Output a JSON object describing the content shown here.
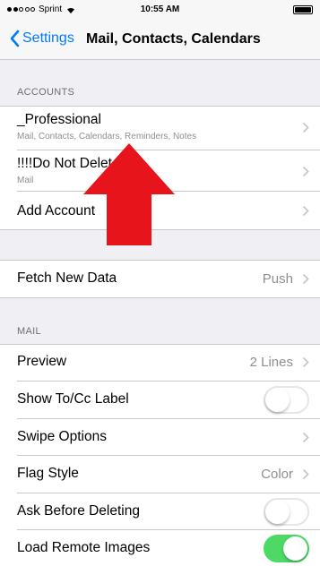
{
  "status_bar": {
    "carrier": "Sprint",
    "time": "10:55 AM"
  },
  "nav": {
    "back_label": "Settings",
    "title": "Mail, Contacts, Calendars"
  },
  "accounts": {
    "header": "ACCOUNTS",
    "items": [
      {
        "label": "_Professional",
        "subtitle": "Mail, Contacts, Calendars, Reminders, Notes"
      },
      {
        "label": "!!!!Do Not Delet",
        "subtitle": "Mail"
      },
      {
        "label": "Add Account"
      }
    ]
  },
  "fetch": {
    "label": "Fetch New Data",
    "value": "Push"
  },
  "mail": {
    "header": "MAIL",
    "preview": {
      "label": "Preview",
      "value": "2 Lines"
    },
    "show_tocc": {
      "label": "Show To/Cc Label",
      "enabled": false
    },
    "swipe_options": {
      "label": "Swipe Options"
    },
    "flag_style": {
      "label": "Flag Style",
      "value": "Color"
    },
    "ask_before_deleting": {
      "label": "Ask Before Deleting",
      "enabled": false
    },
    "load_remote_images": {
      "label": "Load Remote Images",
      "enabled": true
    }
  },
  "colors": {
    "accent": "#007aff",
    "toggle_on": "#4cd964",
    "arrow": "#e8141c"
  }
}
